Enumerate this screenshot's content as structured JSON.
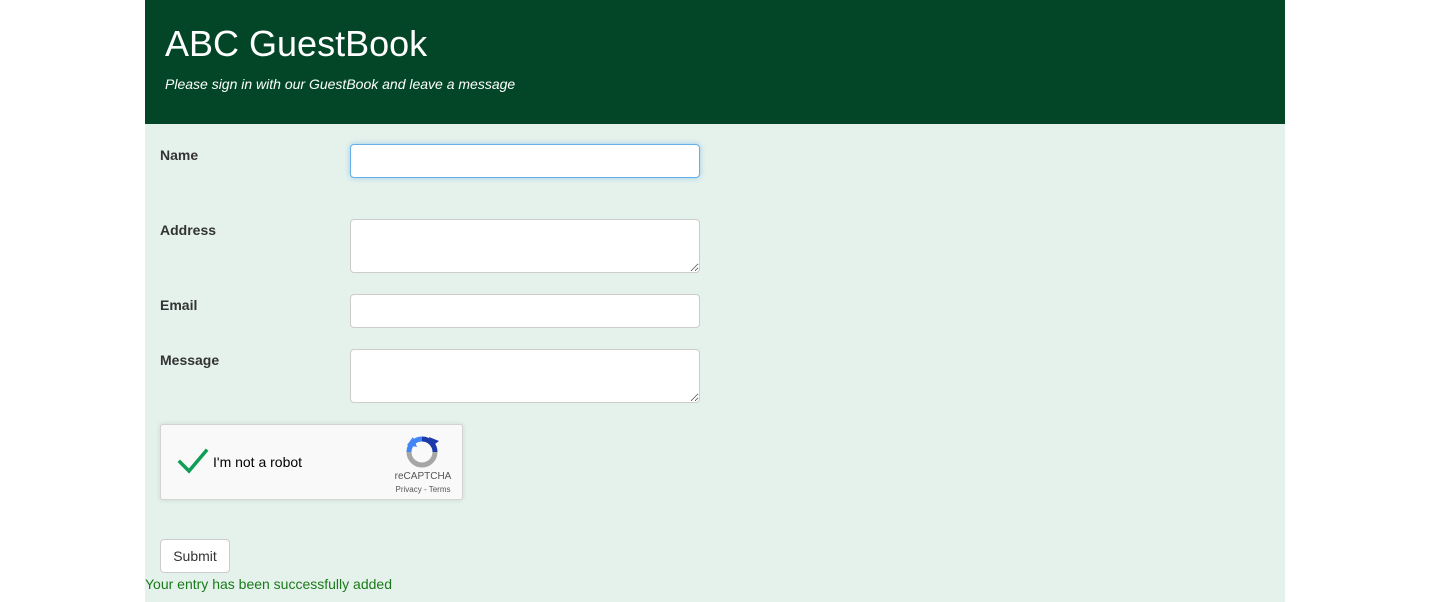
{
  "header": {
    "title": "ABC GuestBook",
    "subtitle": "Please sign in with our GuestBook and leave a message"
  },
  "form": {
    "name_label": "Name",
    "name_value": "",
    "address_label": "Address",
    "address_value": "",
    "email_label": "Email",
    "email_value": "",
    "message_label": "Message",
    "message_value": ""
  },
  "captcha": {
    "label": "I'm not a robot",
    "checked": true,
    "brand": "reCAPTCHA",
    "privacy": "Privacy",
    "separator": " - ",
    "terms": "Terms",
    "check_color": "#0f9d58"
  },
  "submit_label": "Submit",
  "status_message": "Your entry has been successfully added",
  "colors": {
    "header_bg": "#034627",
    "page_bg": "#e5f2ec",
    "success_text": "#1a7a1a"
  }
}
